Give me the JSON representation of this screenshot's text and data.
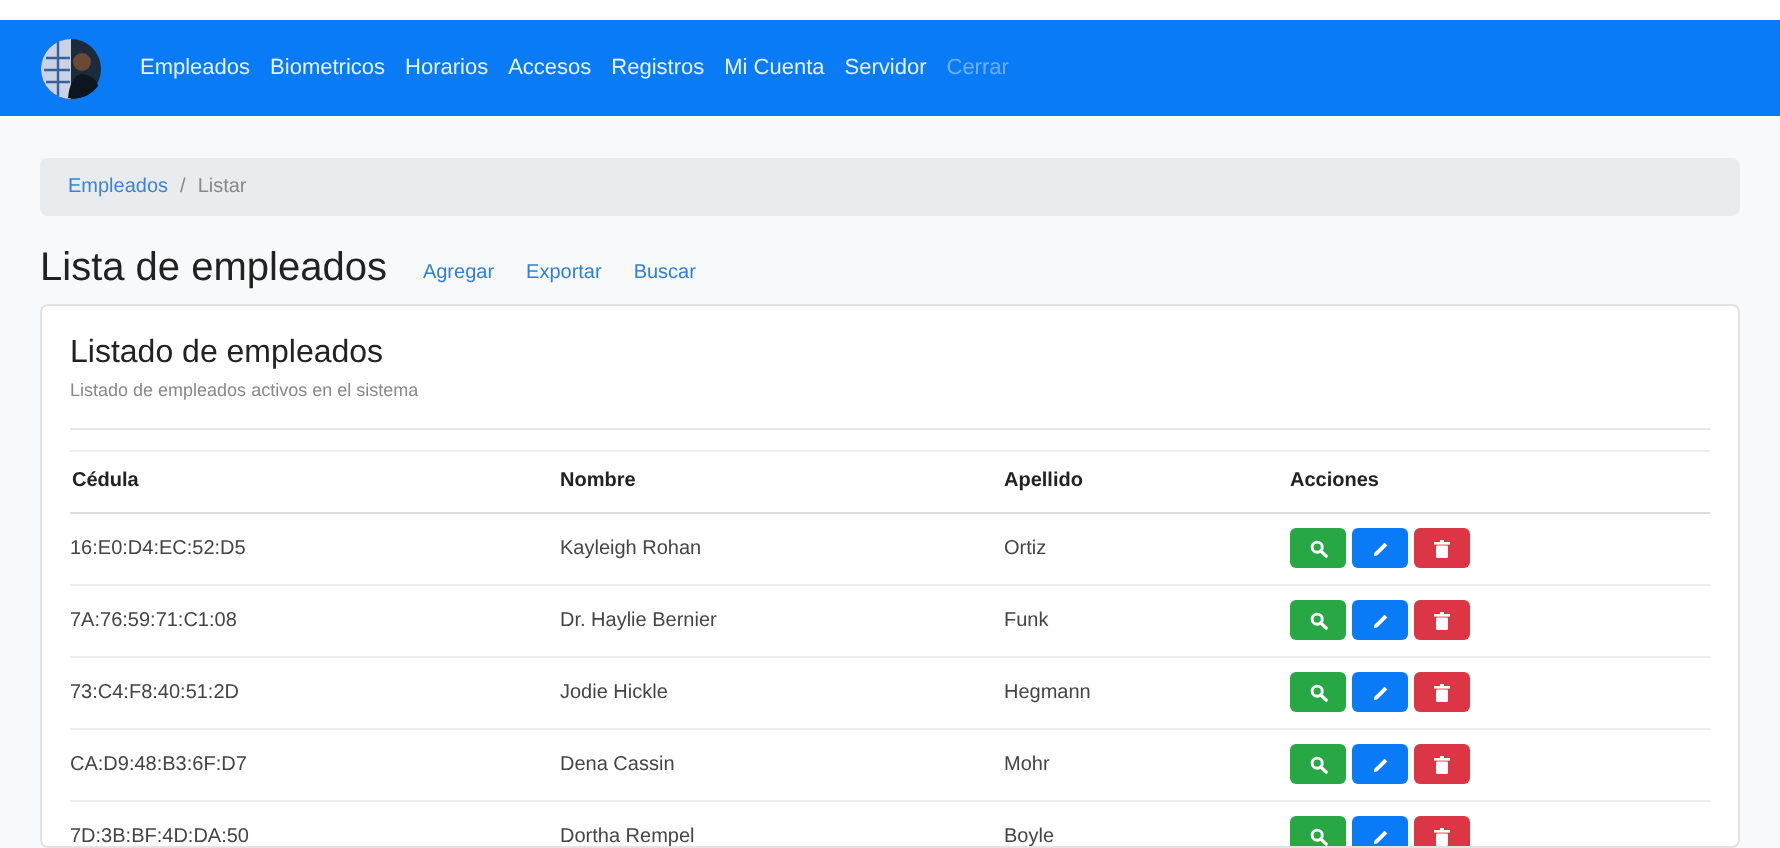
{
  "navbar": {
    "items": [
      {
        "label": "Empleados",
        "disabled": false
      },
      {
        "label": "Biometricos",
        "disabled": false
      },
      {
        "label": "Horarios",
        "disabled": false
      },
      {
        "label": "Accesos",
        "disabled": false
      },
      {
        "label": "Registros",
        "disabled": false
      },
      {
        "label": "Mi Cuenta",
        "disabled": false
      },
      {
        "label": "Servidor",
        "disabled": false
      },
      {
        "label": "Cerrar",
        "disabled": true
      }
    ]
  },
  "breadcrumb": [
    {
      "label": "Empleados",
      "kind": "link"
    },
    {
      "label": "Listar",
      "kind": "current"
    }
  ],
  "breadcrumb_separator": "/",
  "page_title": "Lista de empleados",
  "page_links": [
    "Agregar",
    "Exportar",
    "Buscar"
  ],
  "card": {
    "title": "Listado de empleados",
    "subtitle": "Listado de empleados activos en el sistema"
  },
  "table": {
    "columns": [
      "Cédula",
      "Nombre",
      "Apellido",
      "Acciones"
    ],
    "rows": [
      {
        "cedula": "16:E0:D4:EC:52:D5",
        "nombre": "Kayleigh Rohan",
        "apellido": "Ortiz"
      },
      {
        "cedula": "7A:76:59:71:C1:08",
        "nombre": "Dr. Haylie Bernier",
        "apellido": "Funk"
      },
      {
        "cedula": "73:C4:F8:40:51:2D",
        "nombre": "Jodie Hickle",
        "apellido": "Hegmann"
      },
      {
        "cedula": "CA:D9:48:B3:6F:D7",
        "nombre": "Dena Cassin",
        "apellido": "Mohr"
      },
      {
        "cedula": "7D:3B:BF:4D:DA:50",
        "nombre": "Dortha Rempel",
        "apellido": "Boyle"
      }
    ]
  }
}
